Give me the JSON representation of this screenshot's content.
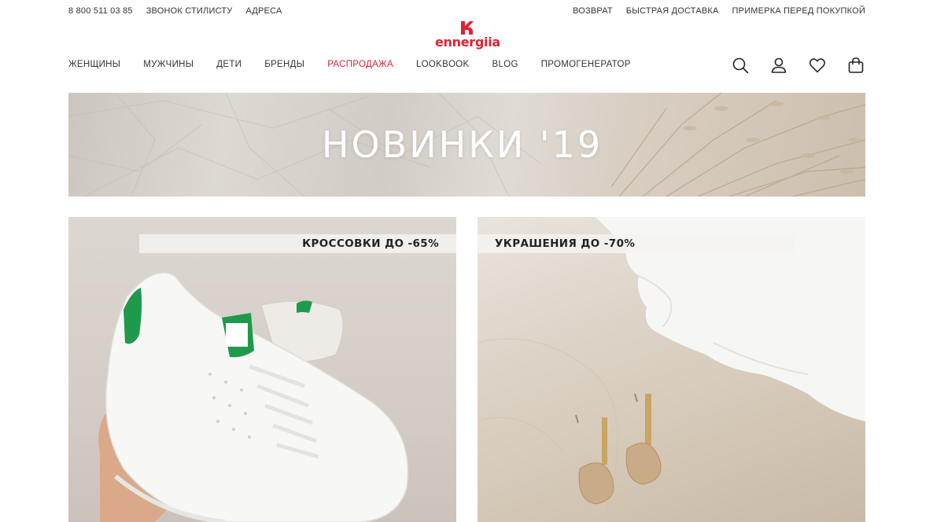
{
  "topbar": {
    "left": [
      "8 800 511 03 85",
      "ЗВОНОК СТИЛИСТУ",
      "АДРЕСА"
    ],
    "right": [
      "ВОЗВРАТ",
      "БЫСТРАЯ ДОСТАВКА",
      "ПРИМЕРКА ПЕРЕД ПОКУПКОЙ"
    ]
  },
  "logo": {
    "text": "ennergiia",
    "color": "#e5202e"
  },
  "nav": [
    "ЖЕНЩИНЫ",
    "МУЖЧИНЫ",
    "ДЕТИ",
    "БРЕНДЫ",
    "РАСПРОДАЖА",
    "LOOKBOOK",
    "BLOG",
    "ПРОМОГЕНЕРАТОР"
  ],
  "header_icons": [
    "search-icon",
    "user-icon",
    "heart-icon",
    "bag-icon"
  ],
  "hero": {
    "title": "НОВИНКИ '19"
  },
  "promos": [
    {
      "label": "КРОССОВКИ ДО -65%"
    },
    {
      "label": "УКРАШЕНИЯ ДО -70%"
    }
  ],
  "colors": {
    "accent": "#e5202e",
    "text": "#222222"
  }
}
